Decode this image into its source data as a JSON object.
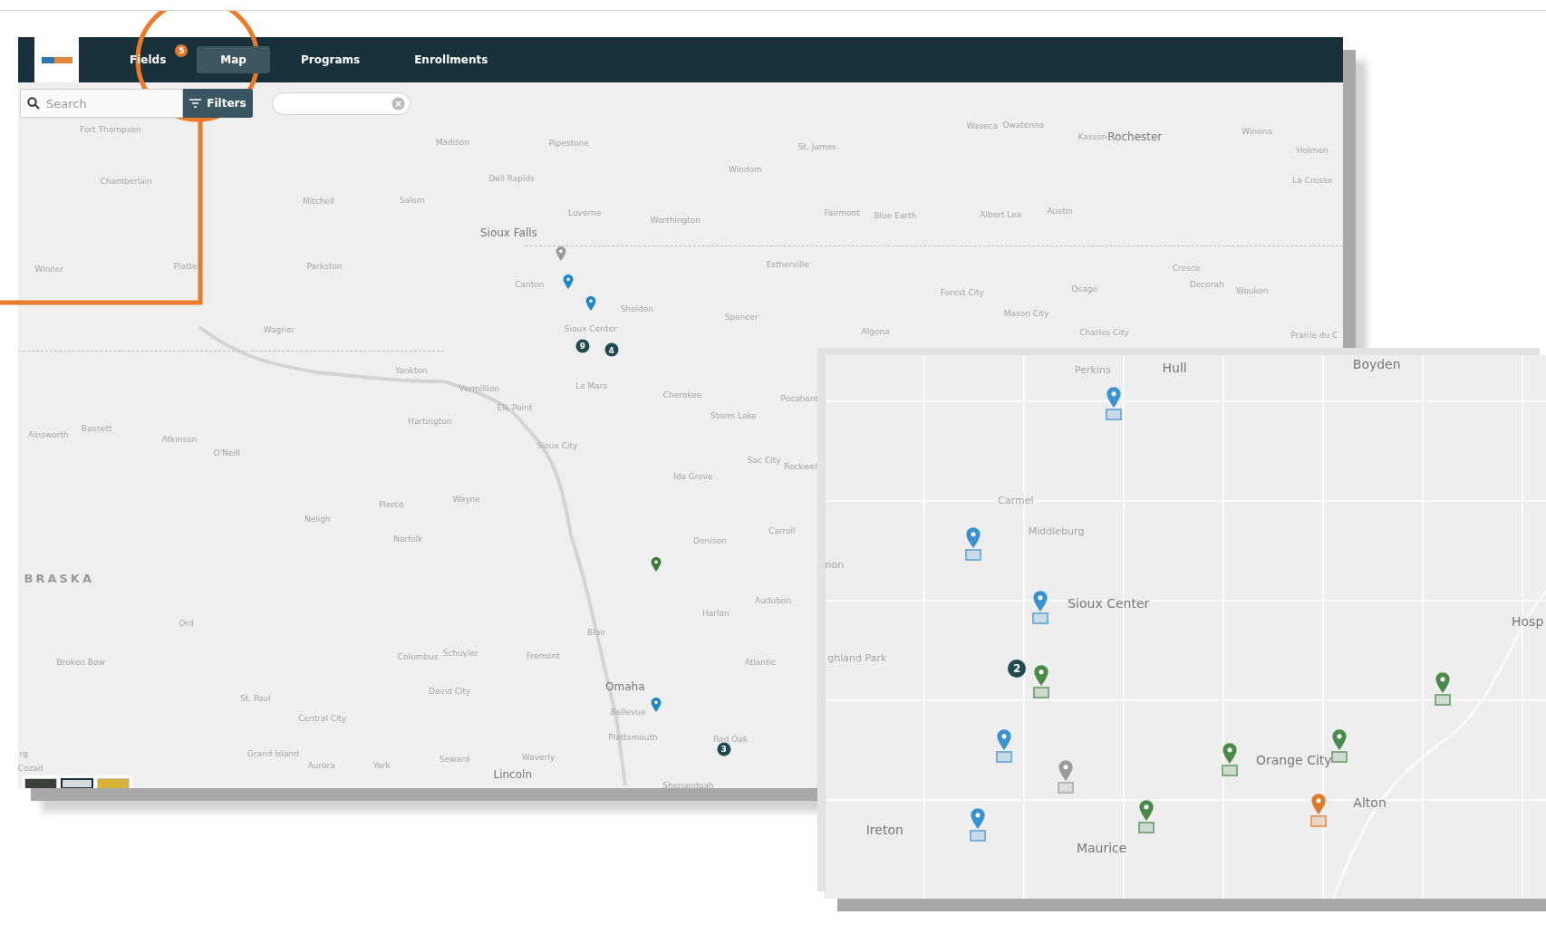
{
  "nav": {
    "tabs": [
      {
        "label": "Fields",
        "selected": false,
        "badge": "5"
      },
      {
        "label": "Map",
        "selected": true
      },
      {
        "label": "Programs",
        "selected": false
      },
      {
        "label": "Enrollments",
        "selected": false
      }
    ]
  },
  "search": {
    "placeholder": "Search"
  },
  "filters_button": "Filters",
  "map": {
    "labels": [
      {
        "text": "Fort Thompson",
        "kind": "minor"
      },
      {
        "text": "Chamberlain",
        "kind": "minor"
      },
      {
        "text": "Winner",
        "kind": "minor"
      },
      {
        "text": "Platte",
        "kind": "minor"
      },
      {
        "text": "Mitchell",
        "kind": "minor"
      },
      {
        "text": "Salem",
        "kind": "minor"
      },
      {
        "text": "Madison",
        "kind": "minor"
      },
      {
        "text": "Pipestone",
        "kind": "minor"
      },
      {
        "text": "Dell Rapids",
        "kind": "minor"
      },
      {
        "text": "Sioux Falls",
        "kind": "major"
      },
      {
        "text": "Luverne",
        "kind": "minor"
      },
      {
        "text": "Worthington",
        "kind": "minor"
      },
      {
        "text": "Windom",
        "kind": "minor"
      },
      {
        "text": "St. James",
        "kind": "minor"
      },
      {
        "text": "Waseca",
        "kind": "minor"
      },
      {
        "text": "Owatonna",
        "kind": "minor"
      },
      {
        "text": "Kasson",
        "kind": "minor"
      },
      {
        "text": "Rochester",
        "kind": "major"
      },
      {
        "text": "Winona",
        "kind": "minor"
      },
      {
        "text": "Holmen",
        "kind": "minor"
      },
      {
        "text": "La Crosse",
        "kind": "minor"
      },
      {
        "text": "Fairmont",
        "kind": "minor"
      },
      {
        "text": "Blue Earth",
        "kind": "minor"
      },
      {
        "text": "Albert Lea",
        "kind": "minor"
      },
      {
        "text": "Austin",
        "kind": "minor"
      },
      {
        "text": "Estherville",
        "kind": "minor"
      },
      {
        "text": "Forest City",
        "kind": "minor"
      },
      {
        "text": "Osage",
        "kind": "minor"
      },
      {
        "text": "Cresco",
        "kind": "minor"
      },
      {
        "text": "Decorah",
        "kind": "minor"
      },
      {
        "text": "Waukon",
        "kind": "minor"
      },
      {
        "text": "Mason City",
        "kind": "minor"
      },
      {
        "text": "Algona",
        "kind": "minor"
      },
      {
        "text": "Charles City",
        "kind": "minor"
      },
      {
        "text": "Prairie du C",
        "kind": "minor"
      },
      {
        "text": "Spencer",
        "kind": "minor"
      },
      {
        "text": "Sheldon",
        "kind": "minor"
      },
      {
        "text": "Canton",
        "kind": "minor"
      },
      {
        "text": "Sioux Center",
        "kind": "minor"
      },
      {
        "text": "Le Mars",
        "kind": "minor"
      },
      {
        "text": "Cherokee",
        "kind": "minor"
      },
      {
        "text": "Pocahont",
        "kind": "minor"
      },
      {
        "text": "Storm Lake",
        "kind": "minor"
      },
      {
        "text": "Wagner",
        "kind": "minor"
      },
      {
        "text": "Parkston",
        "kind": "minor"
      },
      {
        "text": "Yankton",
        "kind": "minor"
      },
      {
        "text": "Vermillion",
        "kind": "minor"
      },
      {
        "text": "Elk Point",
        "kind": "minor"
      },
      {
        "text": "Hartington",
        "kind": "minor"
      },
      {
        "text": "Sioux City",
        "kind": "minor"
      },
      {
        "text": "Ida Grove",
        "kind": "minor"
      },
      {
        "text": "Sac City",
        "kind": "minor"
      },
      {
        "text": "Rockwel",
        "kind": "minor"
      },
      {
        "text": "Ainsworth",
        "kind": "minor"
      },
      {
        "text": "Bassett",
        "kind": "minor"
      },
      {
        "text": "Atkinson",
        "kind": "minor"
      },
      {
        "text": "O'Neill",
        "kind": "minor"
      },
      {
        "text": "Pierce",
        "kind": "minor"
      },
      {
        "text": "Wayne",
        "kind": "minor"
      },
      {
        "text": "Neligh",
        "kind": "minor"
      },
      {
        "text": "Norfolk",
        "kind": "minor"
      },
      {
        "text": "Denison",
        "kind": "minor"
      },
      {
        "text": "Carroll",
        "kind": "minor"
      },
      {
        "text": "BRASKA",
        "kind": "region"
      },
      {
        "text": "Audubon",
        "kind": "minor"
      },
      {
        "text": "Harlan",
        "kind": "minor"
      },
      {
        "text": "Ord",
        "kind": "minor"
      },
      {
        "text": "Blair",
        "kind": "minor"
      },
      {
        "text": "Broken Bow",
        "kind": "minor"
      },
      {
        "text": "Columbus",
        "kind": "minor"
      },
      {
        "text": "Schuyler",
        "kind": "minor"
      },
      {
        "text": "Fremont",
        "kind": "minor"
      },
      {
        "text": "Atlantic",
        "kind": "minor"
      },
      {
        "text": "Omaha",
        "kind": "major"
      },
      {
        "text": "Bellevue",
        "kind": "minor"
      },
      {
        "text": "David City",
        "kind": "minor"
      },
      {
        "text": "St. Paul",
        "kind": "minor"
      },
      {
        "text": "Central City",
        "kind": "minor"
      },
      {
        "text": "Plattsmouth",
        "kind": "minor"
      },
      {
        "text": "Red Oak",
        "kind": "minor"
      },
      {
        "text": "Grand Island",
        "kind": "minor"
      },
      {
        "text": "Aurora",
        "kind": "minor"
      },
      {
        "text": "York",
        "kind": "minor"
      },
      {
        "text": "Seward",
        "kind": "minor"
      },
      {
        "text": "Waverly",
        "kind": "minor"
      },
      {
        "text": "Lincoln",
        "kind": "major"
      },
      {
        "text": "Shenandoah",
        "kind": "minor"
      },
      {
        "text": "rg",
        "kind": "minor"
      },
      {
        "text": "Cozad",
        "kind": "minor"
      }
    ],
    "markers": [
      {
        "kind": "pin",
        "color": "#9a9a9a"
      },
      {
        "kind": "pin",
        "color": "#1f86c8"
      },
      {
        "kind": "pin",
        "color": "#1f86c8"
      },
      {
        "kind": "cluster",
        "count": "9"
      },
      {
        "kind": "cluster",
        "count": "4"
      },
      {
        "kind": "pin",
        "color": "#3c7a3c"
      },
      {
        "kind": "pin",
        "color": "#1f86c8"
      },
      {
        "kind": "cluster",
        "count": "3"
      }
    ],
    "basemaps": [
      {
        "selected": false
      },
      {
        "selected": true
      },
      {
        "selected": false
      }
    ]
  },
  "inset": {
    "labels": [
      {
        "text": "Perkins",
        "kind": "minor"
      },
      {
        "text": "Hull",
        "kind": "major"
      },
      {
        "text": "Boyden",
        "kind": "major"
      },
      {
        "text": "Carmel",
        "kind": "minor"
      },
      {
        "text": "Middleburg",
        "kind": "minor"
      },
      {
        "text": "non",
        "kind": "minor"
      },
      {
        "text": "Sioux Center",
        "kind": "major"
      },
      {
        "text": "ghland Park",
        "kind": "minor"
      },
      {
        "text": "Hosp",
        "kind": "major"
      },
      {
        "text": "Orange City",
        "kind": "major"
      },
      {
        "text": "Alton",
        "kind": "major"
      },
      {
        "text": "Ireton",
        "kind": "major"
      },
      {
        "text": "Maurice",
        "kind": "major"
      }
    ],
    "markers": [
      {
        "kind": "pin",
        "color": "#3a92d0"
      },
      {
        "kind": "pin",
        "color": "#3a92d0"
      },
      {
        "kind": "pin",
        "color": "#3a92d0"
      },
      {
        "kind": "cluster",
        "count": "2"
      },
      {
        "kind": "pin",
        "color": "#4a8a4a"
      },
      {
        "kind": "pin",
        "color": "#3a92d0"
      },
      {
        "kind": "pin",
        "color": "#9a9a9a"
      },
      {
        "kind": "pin",
        "color": "#4a8a4a"
      },
      {
        "kind": "pin",
        "color": "#4a8a4a"
      },
      {
        "kind": "pin",
        "color": "#4a8a4a"
      },
      {
        "kind": "pin",
        "color": "#3a92d0"
      },
      {
        "kind": "pin",
        "color": "#4a8a4a"
      },
      {
        "kind": "pin",
        "color": "#e07a2a"
      }
    ]
  }
}
